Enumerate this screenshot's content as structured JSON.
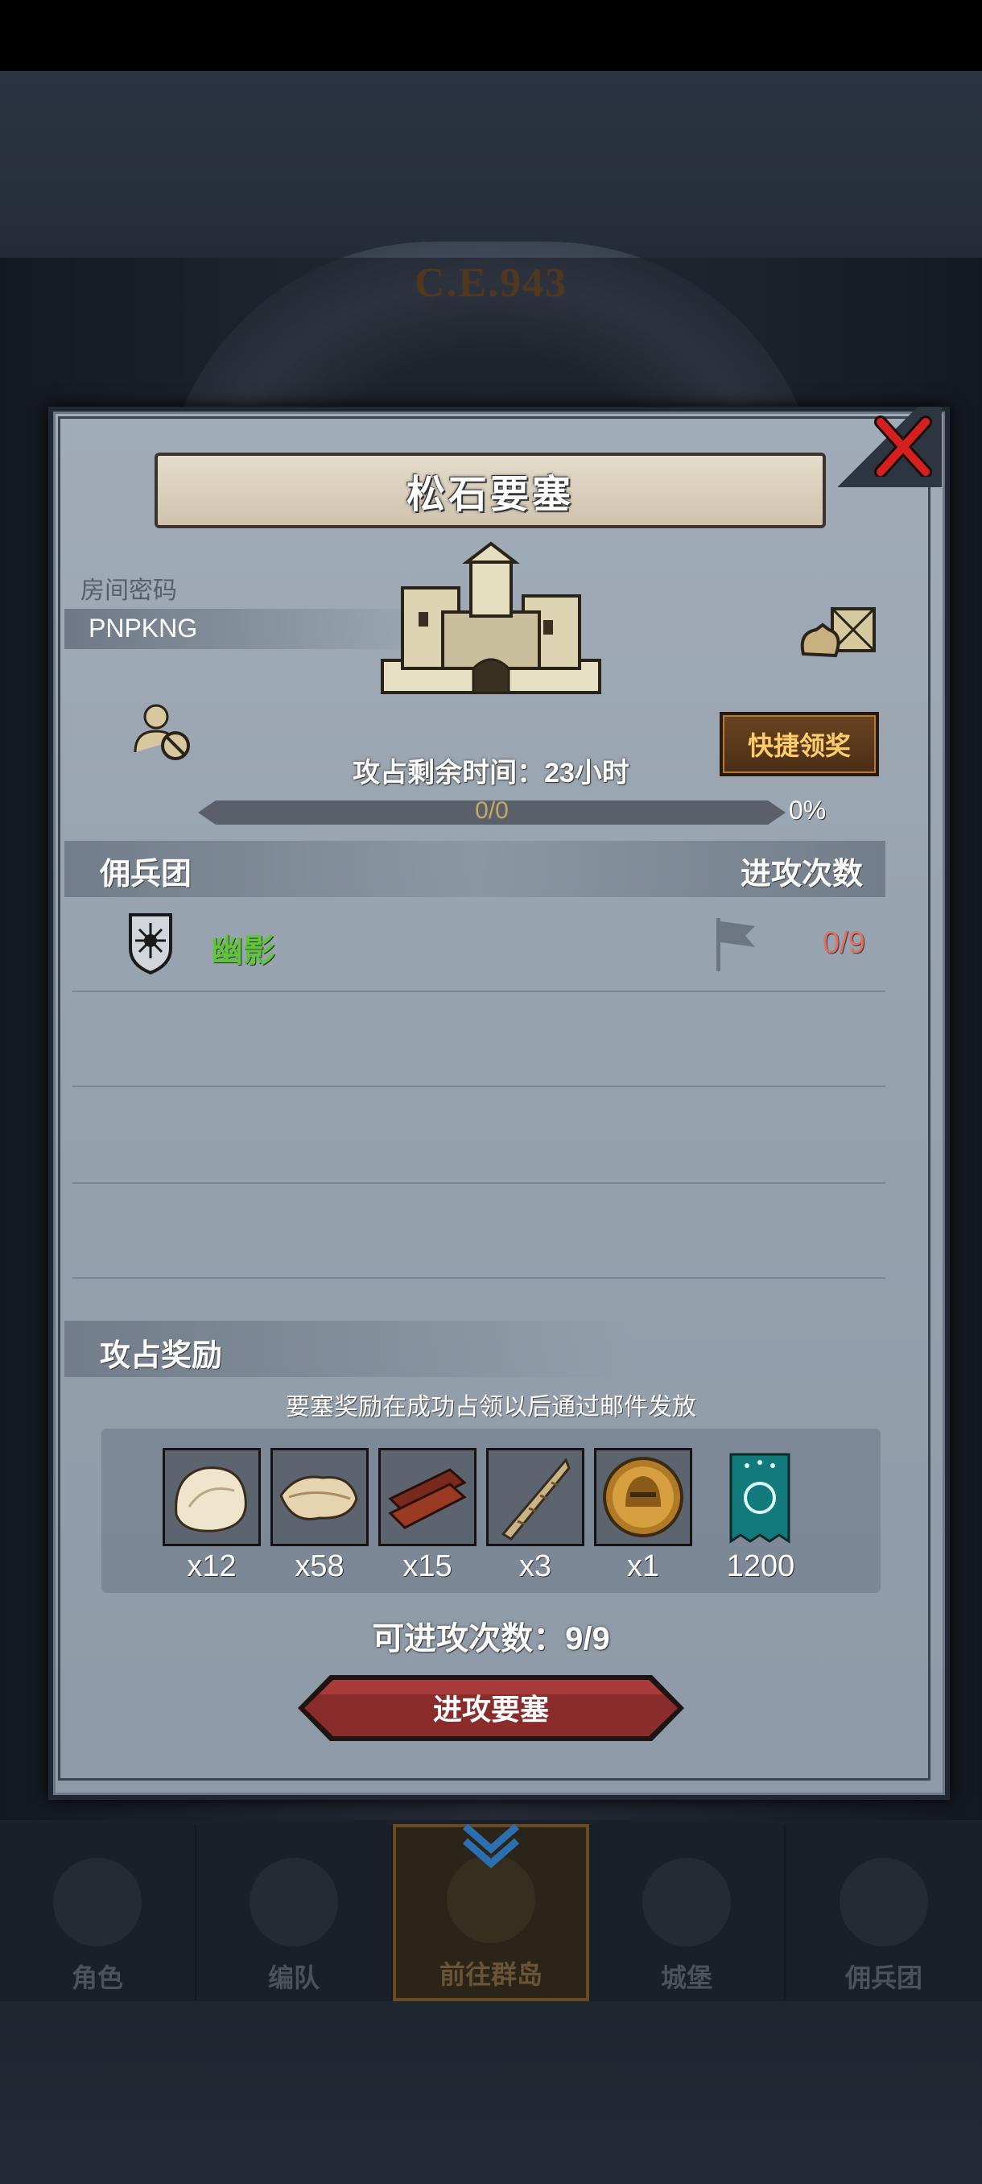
{
  "background": {
    "year_label": "C.E.943"
  },
  "modal": {
    "title": "松石要塞",
    "room_password_label": "房间密码",
    "room_password": "PNPKNG",
    "quick_claim_label": "快捷领奖",
    "remaining_time": "攻占剩余时间：23小时",
    "progress": {
      "text": "0/0",
      "percent_text": "0%",
      "fraction": 0
    },
    "mercenary_header": "佣兵团",
    "attack_count_header": "进攻次数",
    "mercenary": {
      "name": "幽影",
      "count": "0/9"
    },
    "reward_header": "攻占奖励",
    "reward_note": "要塞奖励在成功占领以后通过邮件发放",
    "rewards": [
      {
        "icon": "fur-pelt-icon",
        "qty": "x12"
      },
      {
        "icon": "hide-leather-icon",
        "qty": "x58"
      },
      {
        "icon": "wood-planks-icon",
        "qty": "x15"
      },
      {
        "icon": "twisted-horn-icon",
        "qty": "x3"
      },
      {
        "icon": "gold-helmet-coin-icon",
        "qty": "x1"
      },
      {
        "icon": "guild-banner-icon",
        "qty": "1200"
      }
    ],
    "attempts_text": "可进攻次数：9/9",
    "attack_button_label": "进攻要塞"
  },
  "nav": {
    "tabs": [
      {
        "label": "角色",
        "icon": "knight-icon"
      },
      {
        "label": "编队",
        "icon": "formation-icon"
      },
      {
        "label": "前往群岛",
        "icon": "compass-icon",
        "active": true
      },
      {
        "label": "城堡",
        "icon": "castle-icon"
      },
      {
        "label": "佣兵团",
        "icon": "ship-icon"
      }
    ]
  },
  "colors": {
    "accent_gold": "#ffcc66",
    "merc_green": "#5fc63a",
    "count_red": "#e07060",
    "button_red": "#8a2c2c"
  }
}
